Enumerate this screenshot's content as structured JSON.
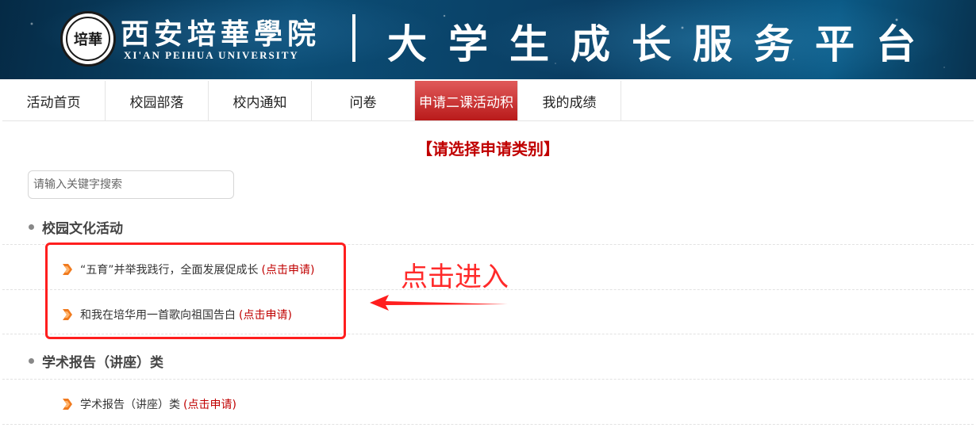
{
  "header": {
    "logo_text": "培華",
    "university_cn": "西安培華學院",
    "university_en": "XI'AN PEIHUA UNIVERSITY",
    "platform_title": "大学生成长服务平台"
  },
  "nav": {
    "items": [
      {
        "label": "活动首页"
      },
      {
        "label": "校园部落"
      },
      {
        "label": "校内通知"
      },
      {
        "label": "问卷"
      },
      {
        "label": "申请二课活动积"
      },
      {
        "label": "我的成绩"
      }
    ],
    "active_index": 4
  },
  "main": {
    "title": "【请选择申请类别】",
    "search_placeholder": "请输入关键字搜索",
    "categories": [
      {
        "name": "校园文化活动",
        "items": [
          {
            "text": "“五育”并举我践行，全面发展促成长",
            "link": "(点击申请)"
          },
          {
            "text": "和我在培华用一首歌向祖国告白",
            "link": "(点击申请)"
          }
        ]
      },
      {
        "name": "学术报告（讲座）类",
        "items": [
          {
            "text": "学术报告（讲座）类",
            "link": "(点击申请)"
          }
        ]
      }
    ]
  },
  "annotation": {
    "text": "点击进入"
  },
  "colors": {
    "accent_red": "#c00000",
    "nav_active": "#c21f1f",
    "annotation_red": "#ff1e1e",
    "arrow_orange": "#f07a1e"
  }
}
